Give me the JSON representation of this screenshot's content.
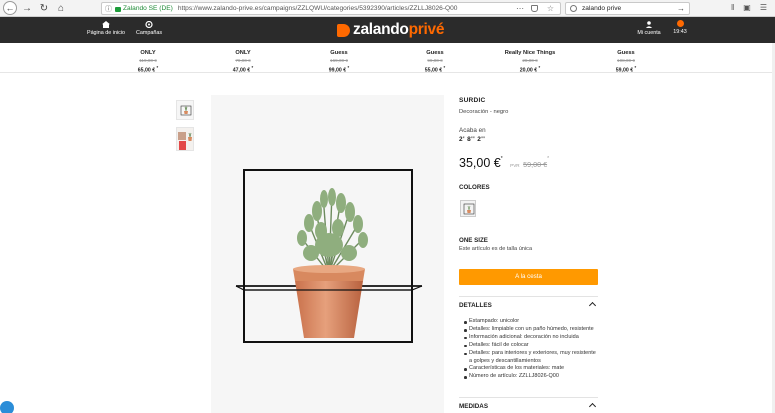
{
  "browser": {
    "site_identity": "Zalando SE (DE)",
    "url": "https://www.zalando-prive.es/campaigns/ZZLQWU/categories/5392390/articles/ZZLLJ8026-Q00",
    "search_value": "zalando prive",
    "icons": [
      "back-icon",
      "forward-icon",
      "reload-icon",
      "home-icon",
      "info-icon",
      "lock-icon",
      "menu-dots-icon",
      "pocket-icon",
      "star-icon",
      "search-icon",
      "go-arrow-icon"
    ]
  },
  "header": {
    "home_label": "Página de inicio",
    "campaigns_label": "Campañas",
    "logo_part1": "zalando",
    "logo_part2": "privé",
    "account_label": "Mi cuenta",
    "timer": "19:43",
    "accent": "#ff6900"
  },
  "brands": [
    {
      "name": "ONLY",
      "old": "119,00 €",
      "price": "65,00 €"
    },
    {
      "name": "ONLY",
      "old": "79,90 €",
      "price": "47,00 €"
    },
    {
      "name": "Guess",
      "old": "169,00 €",
      "price": "99,00 €"
    },
    {
      "name": "Guess",
      "old": "99,00 €",
      "price": "55,00 €"
    },
    {
      "name": "Really Nice Things",
      "old": "28,00 €",
      "price": "20,00 €"
    },
    {
      "name": "Guess",
      "old": "108,00 €",
      "price": "59,00 €"
    }
  ],
  "price_star": "*",
  "product": {
    "brand": "SURDIC",
    "description": "Decoración - negro",
    "size_label": "Acaba en",
    "size_value": "2' 8'' 2''",
    "price": "35,00 €",
    "old_prefix": "PVR",
    "old_price": "59,00 €",
    "colors_label": "COLORES",
    "size_header": "ONE SIZE",
    "size_note": "Este artículo es de talla única",
    "cart_label": "A la cesta",
    "cart_color": "#ff9900",
    "details_label": "DETALLES",
    "details": [
      "Estampado: unicolor",
      "Detalles: limpiable con un paño húmedo, resistente",
      "Información adicional: decoración no incluida",
      "Detalles: fácil de colocar",
      "Detalles: para interiores y exteriores, muy resistente a golpes y descantillamientos",
      "Características de los materiales: mate",
      "Número de artículo: ZZLLJ8026-Q00"
    ],
    "measures_label": "MEDIDAS"
  }
}
